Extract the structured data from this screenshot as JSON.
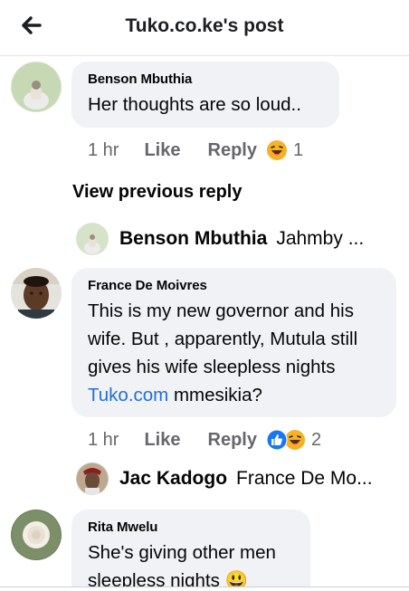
{
  "header": {
    "title": "Tuko.co.ke's post"
  },
  "comments": [
    {
      "author": "Benson Mbuthia",
      "text": "Her thoughts are so loud..",
      "time": "1 hr",
      "like": "Like",
      "reply": "Reply",
      "reaction_count": "1",
      "reactions": [
        "haha"
      ]
    },
    {
      "author": "France De Moivres",
      "text_before": "This is my new governor and his wife. But , apparently, Mutula still  gives his wife sleepless nights ",
      "text_link": "Tuko.com",
      "text_after": " mmesikia?",
      "time": "1 hr",
      "like": "Like",
      "reply": "Reply",
      "reaction_count": "2",
      "reactions": [
        "like",
        "haha"
      ]
    },
    {
      "author": "Rita Mwelu",
      "text": "She's giving other men sleepless nights 😃"
    }
  ],
  "view_previous": "View previous reply",
  "replies": [
    {
      "name": "Benson Mbuthia",
      "preview": "Jahmby ..."
    },
    {
      "name": "Jac Kadogo",
      "preview": "France De Mo..."
    }
  ],
  "colors": {
    "link": "#216fdb",
    "bubble": "#f0f2f5",
    "meta": "#65676b",
    "like_blue": "#1877f2",
    "haha_yellow": "#f7b125"
  }
}
